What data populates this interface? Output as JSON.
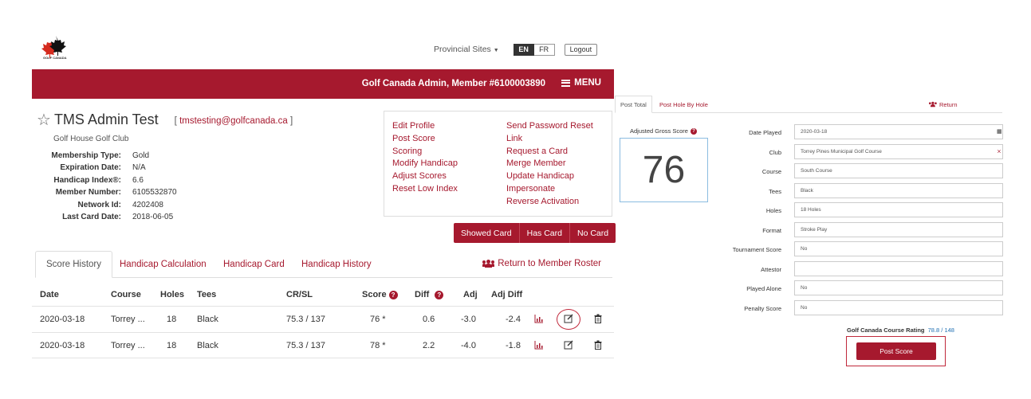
{
  "header": {
    "logo_text": "GOLF CANADA",
    "provincial_sites": "Provincial Sites",
    "lang_en": "EN",
    "lang_fr": "FR",
    "logout": "Logout"
  },
  "banner": {
    "user": "Golf Canada Admin, Member #6100003890",
    "menu": "MENU"
  },
  "member": {
    "name": "TMS Admin Test",
    "email_open": "[",
    "email": "tmstesting@golfcanada.ca",
    "email_close": "]",
    "club": "Golf House Golf Club",
    "info": [
      {
        "label": "Membership Type:",
        "value": "Gold"
      },
      {
        "label": "Expiration Date:",
        "value": "N/A"
      },
      {
        "label": "Handicap Index®:",
        "value": "6.6"
      },
      {
        "label": "Member Number:",
        "value": "6105532870"
      },
      {
        "label": "Network Id:",
        "value": "4202408"
      },
      {
        "label": "Last Card Date:",
        "value": "2018-06-05"
      }
    ]
  },
  "actions": {
    "left": [
      "Edit Profile",
      "Post Score",
      "Scoring",
      "Modify Handicap",
      "Adjust Scores",
      "Reset Low Index"
    ],
    "right": [
      "Send Password Reset",
      "Link",
      "Request a Card",
      "Merge Member",
      "Update Handicap",
      "Impersonate",
      "Reverse Activation"
    ]
  },
  "card_buttons": [
    "Showed Card",
    "Has Card",
    "No Card"
  ],
  "tabs": [
    "Score History",
    "Handicap Calculation",
    "Handicap Card",
    "Handicap History"
  ],
  "return_roster": "Return to Member Roster",
  "table": {
    "headers": {
      "date": "Date",
      "course": "Course",
      "holes": "Holes",
      "tees": "Tees",
      "crsl": "CR/SL",
      "score": "Score",
      "diff": "Diff",
      "adj": "Adj",
      "adjdiff": "Adj Diff"
    },
    "rows": [
      {
        "date": "2020-03-18",
        "course": "Torrey ...",
        "holes": "18",
        "tees": "Black",
        "crsl": "75.3 / 137",
        "score": "76 *",
        "diff": "0.6",
        "adj": "-3.0",
        "adjdiff": "-2.4"
      },
      {
        "date": "2020-03-18",
        "course": "Torrey ...",
        "holes": "18",
        "tees": "Black",
        "crsl": "75.3 / 137",
        "score": "78 *",
        "diff": "2.2",
        "adj": "-4.0",
        "adjdiff": "-1.8"
      }
    ]
  },
  "post_panel": {
    "tabs": [
      "Post Total",
      "Post Hole By Hole"
    ],
    "return": "Return",
    "ags_label": "Adjusted Gross Score",
    "ags_value": "76",
    "fields": [
      {
        "label": "Date Played",
        "value": "2020-03-18"
      },
      {
        "label": "Club",
        "value": "Torrey Pines Municipal Golf Course"
      },
      {
        "label": "Course",
        "value": "South Course"
      },
      {
        "label": "Tees",
        "value": "Black"
      },
      {
        "label": "Holes",
        "value": "18 Holes"
      },
      {
        "label": "Format",
        "value": "Stroke Play"
      },
      {
        "label": "Tournament Score",
        "value": "No"
      },
      {
        "label": "Attestor",
        "value": ""
      },
      {
        "label": "Played Alone",
        "value": "No"
      },
      {
        "label": "Penalty Score",
        "value": "No"
      }
    ],
    "rating_label": "Golf Canada Course Rating",
    "rating_value": "78.8 / 148",
    "post_button": "Post Score"
  },
  "colors": {
    "brand": "#a6192e",
    "highlight_blue": "#8bbce0"
  }
}
